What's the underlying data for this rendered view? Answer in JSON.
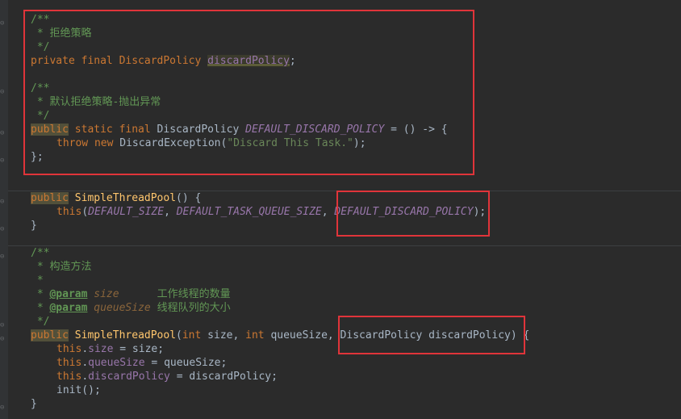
{
  "code": {
    "block1": {
      "doc_open": "/**",
      "doc_text": " * 拒绝策略",
      "doc_close": " */",
      "field_decl_prefix": "private final DiscardPolicy ",
      "field_name": "discardPolicy",
      "field_decl_suffix": ";"
    },
    "block2": {
      "doc_open": "/**",
      "doc_text": " * 默认拒绝策略-抛出异常",
      "doc_close": " */",
      "kw_public": "public",
      "decl_mid": " static final ",
      "type": "DiscardPolicy ",
      "const_name": "DEFAULT_DISCARD_POLICY",
      "decl_tail": " = () -> {",
      "throw_kw": "throw new ",
      "exception_call": "DiscardException(",
      "exception_msg": "\"Discard This Task.\"",
      "exception_end": ");",
      "close": "};"
    },
    "block3": {
      "kw_public": "public",
      "ctor_name": "SimpleThreadPool",
      "ctor_sig": "() {",
      "this_kw": "this",
      "arg_open": "(",
      "arg1": "DEFAULT_SIZE",
      "comma1": ", ",
      "arg2": "DEFAULT_TASK_QUEUE_SIZE",
      "comma2": ", ",
      "arg3": "DEFAULT_DISCARD_POLICY",
      "arg_close": ");",
      "close": "}"
    },
    "block4": {
      "doc_open": "/**",
      "doc_text": " * 构造方法",
      "doc_blank": " *",
      "param_tag": "@param",
      "param1_name": "size",
      "param1_desc": "工作线程的数量",
      "param2_name": "queueSize",
      "param2_desc": "线程队列的大小",
      "doc_close": " */",
      "kw_public": "public",
      "ctor_name": "SimpleThreadPool",
      "sig_open": "(",
      "int_kw": "int",
      "p1": " size, ",
      "p2": " queueSize, ",
      "p3": "DiscardPolicy discardPolicy",
      "sig_close": ") {",
      "this_kw": "this",
      "assign1_field": "size",
      "assign1_rhs": " = size;",
      "assign2_field": "queueSize",
      "assign2_rhs": " = queueSize;",
      "assign3_field": "discardPolicy",
      "assign3_rhs": " = discardPolicy;",
      "init_call": "init();",
      "close": "}"
    }
  },
  "colors": {
    "background": "#2b2b2b",
    "keyword": "#cc7832",
    "doc_comment": "#629755",
    "field": "#9876aa",
    "method": "#ffc66d",
    "string": "#6a8759",
    "annotation_box": "#e0343a"
  }
}
